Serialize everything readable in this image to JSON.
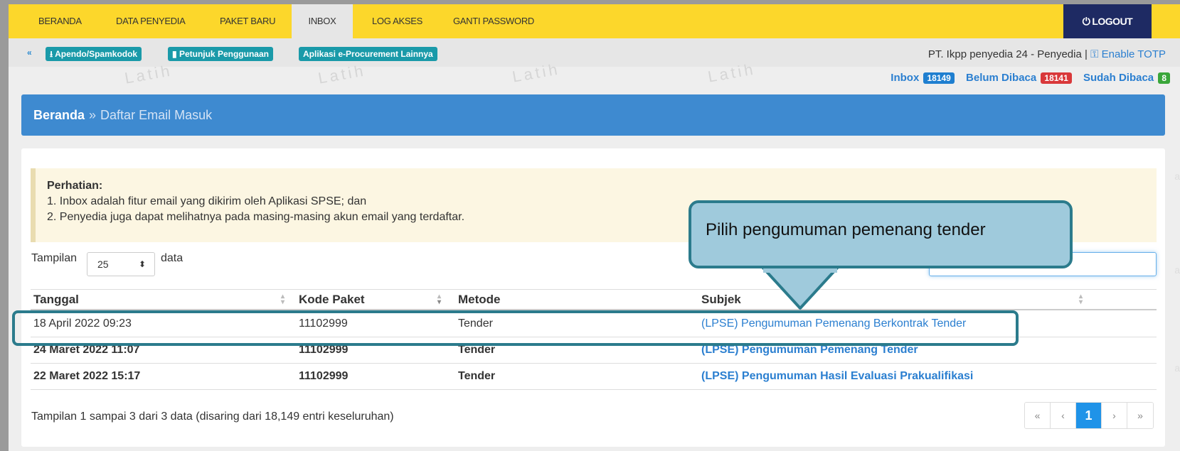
{
  "nav": {
    "items": [
      "BERANDA",
      "DATA PENYEDIA",
      "PAKET BARU",
      "INBOX",
      "LOG AKSES",
      "GANTI PASSWORD"
    ],
    "active": "INBOX",
    "logout": "LOGOUT"
  },
  "subbar": {
    "buttons": [
      "Apendo/Spamkodok",
      "Petunjuk Penggunaan",
      "Aplikasi e-Procurement Lainnya"
    ],
    "account": "PT. Ikpp penyedia 24 - Penyedia |",
    "totp": "Enable TOTP"
  },
  "counters": {
    "inbox_label": "Inbox",
    "inbox_count": "18149",
    "unread_label": "Belum Dibaca",
    "unread_count": "18141",
    "read_label": "Sudah Dibaca",
    "read_count": "8"
  },
  "watermark": "Latih",
  "breadcrumb": {
    "home": "Beranda",
    "sep": "»",
    "current": "Daftar Email Masuk"
  },
  "alert": {
    "title": "Perhatian:",
    "line1": "1. Inbox adalah fitur email yang dikirim oleh Aplikasi SPSE; dan",
    "line2": "2. Penyedia juga dapat melihatnya pada masing-masing akun email yang terdaftar."
  },
  "length": {
    "before": "Tampilan",
    "value": "25",
    "after": "data"
  },
  "table": {
    "headers": [
      "Tanggal",
      "Kode Paket",
      "Metode",
      "Subjek"
    ],
    "rows": [
      {
        "tanggal": "18 April 2022 09:23",
        "kode": "11102999",
        "metode": "Tender",
        "subjek": "(LPSE) Pengumuman Pemenang Berkontrak Tender"
      },
      {
        "tanggal": "24 Maret 2022 11:07",
        "kode": "11102999",
        "metode": "Tender",
        "subjek": "(LPSE) Pengumuman Pemenang Tender"
      },
      {
        "tanggal": "22 Maret 2022 15:17",
        "kode": "11102999",
        "metode": "Tender",
        "subjek": "(LPSE) Pengumuman Hasil Evaluasi Prakualifikasi"
      }
    ]
  },
  "info": "Tampilan 1 sampai 3 dari 3 data (disaring dari 18,149 entri keseluruhan)",
  "pager": {
    "first": "«",
    "prev": "‹",
    "current": "1",
    "next": "›",
    "last": "»"
  },
  "callout": "Pilih pengumuman pemenang tender",
  "colors": {
    "navbar": "#fcd72b",
    "logout": "#1e2a63",
    "accent": "#3e8ad0",
    "callout": "#9fcadc",
    "callout_border": "#2b7b8c"
  }
}
